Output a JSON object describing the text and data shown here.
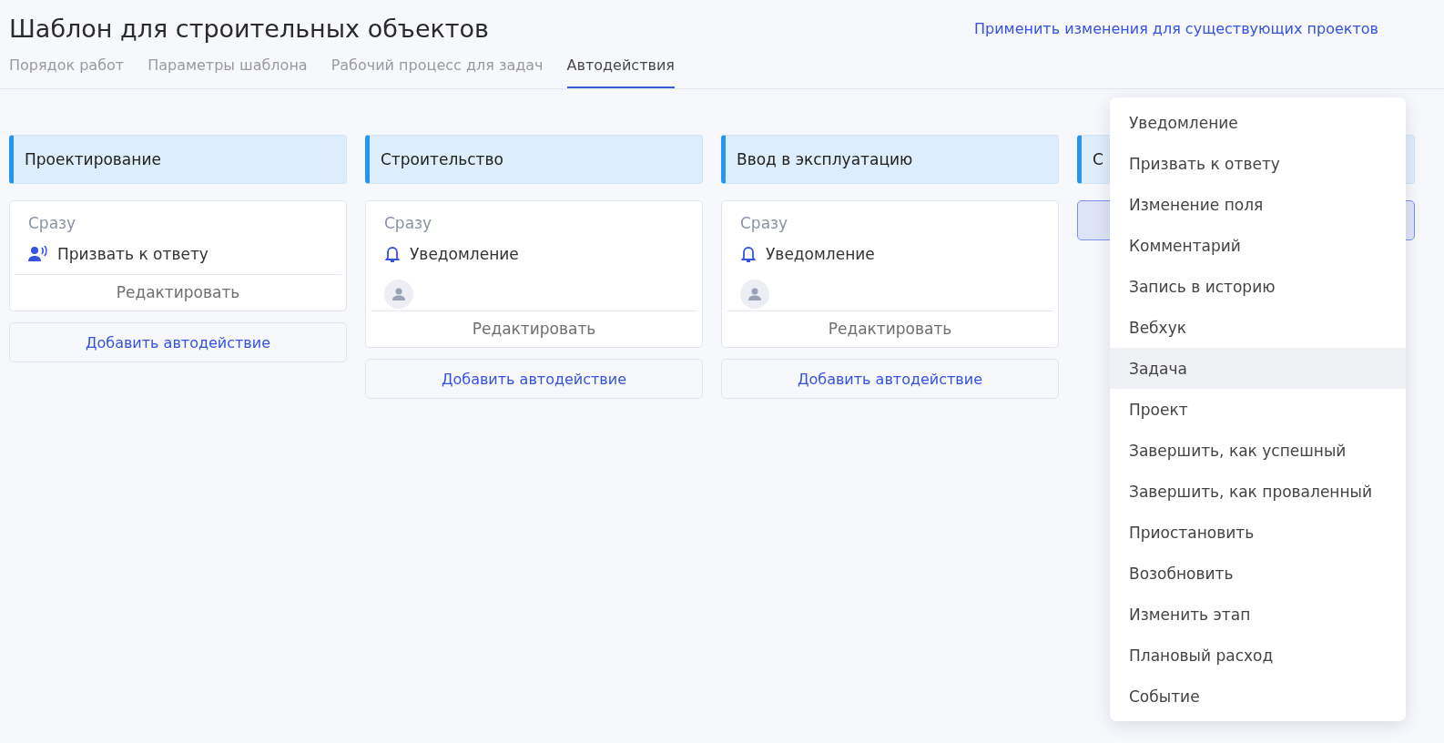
{
  "title": "Шаблон для строительных объектов",
  "apply_link": "Применить изменения для существующих проектов",
  "tabs": [
    {
      "label": "Порядок работ",
      "selected": false
    },
    {
      "label": "Параметры шаблона",
      "selected": false
    },
    {
      "label": "Рабочий процесс для задач",
      "selected": false
    },
    {
      "label": "Автодействия",
      "selected": true
    }
  ],
  "stages": [
    {
      "title": "Проектирование",
      "actions": [
        {
          "timing": "Сразу",
          "kind": "call",
          "label": "Призвать к ответу",
          "assignee": false,
          "edit": "Редактировать"
        }
      ],
      "add_button": {
        "label": "Добавить автодействие",
        "active": false
      }
    },
    {
      "title": "Строительство",
      "actions": [
        {
          "timing": "Сразу",
          "kind": "notification",
          "label": "Уведомление",
          "assignee": true,
          "edit": "Редактировать"
        }
      ],
      "add_button": {
        "label": "Добавить автодействие",
        "active": false
      }
    },
    {
      "title": "Ввод в эксплуатацию",
      "actions": [
        {
          "timing": "Сразу",
          "kind": "notification",
          "label": "Уведомление",
          "assignee": true,
          "edit": "Редактировать"
        }
      ],
      "add_button": {
        "label": "Добавить автодействие",
        "active": false
      }
    },
    {
      "title": "С",
      "add_button": {
        "active": true
      }
    }
  ],
  "menu": [
    {
      "label": "Уведомление",
      "selected": false
    },
    {
      "label": "Призвать к ответу",
      "selected": false
    },
    {
      "label": "Изменение поля",
      "selected": false
    },
    {
      "label": "Комментарий",
      "selected": false
    },
    {
      "label": "Запись в историю",
      "selected": false
    },
    {
      "label": "Вебхук",
      "selected": false
    },
    {
      "label": "Задача",
      "selected": true
    },
    {
      "label": "Проект",
      "selected": false
    },
    {
      "label": "Завершить, как успешный",
      "selected": false
    },
    {
      "label": "Завершить, как проваленный",
      "selected": false
    },
    {
      "label": "Приостановить",
      "selected": false
    },
    {
      "label": "Возобновить",
      "selected": false
    },
    {
      "label": "Изменить этап",
      "selected": false
    },
    {
      "label": "Плановый расход",
      "selected": false
    },
    {
      "label": "Событие",
      "selected": false
    }
  ]
}
